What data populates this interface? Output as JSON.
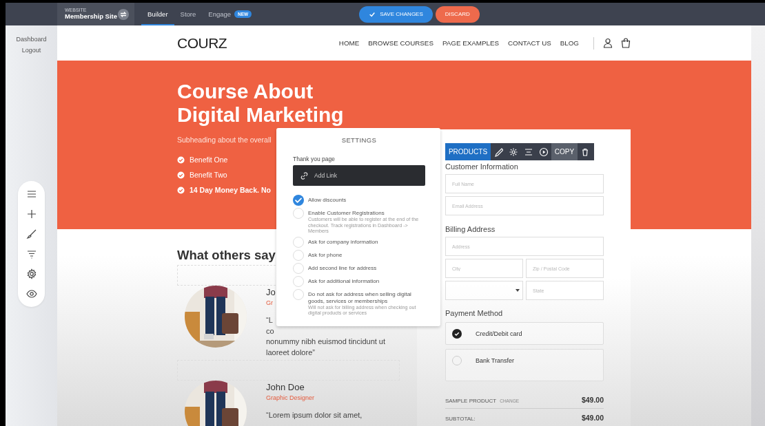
{
  "top_bar": {
    "website_label": "WEBSITE",
    "site_name": "Membership Site",
    "tabs": [
      {
        "label": "Builder",
        "selected": true
      },
      {
        "label": "Store",
        "selected": false
      },
      {
        "label": "Engage",
        "selected": false,
        "badge": "NEW"
      }
    ],
    "buttons": [
      {
        "label": "SAVE CHANGES",
        "kind": "primary"
      },
      {
        "label": "DISCARD",
        "kind": "danger"
      }
    ]
  },
  "sidebar": {
    "links": [
      "Dashboard",
      "Logout"
    ]
  },
  "site_header": {
    "logo": "COURZ",
    "nav": [
      "HOME",
      "BROWSE COURSES",
      "PAGE EXAMPLES",
      "CONTACT US",
      "BLOG"
    ]
  },
  "hero": {
    "title_lines": [
      "Course About",
      "Digital Marketing"
    ],
    "subheading": "Subheading about the overall",
    "benefits": [
      {
        "text": "Benefit One",
        "bold": false
      },
      {
        "text": "Benefit Two",
        "bold": false
      },
      {
        "text": "14 Day Money Back. No",
        "bold": true
      }
    ]
  },
  "testimonials": {
    "heading": "What others say",
    "items": [
      {
        "name": "Jo",
        "role": "Gr",
        "quote_lines": [
          "“L",
          "co",
          "nonummy nibh euismod tincidunt ut",
          "laoreet dolore”"
        ]
      },
      {
        "name": "John Doe",
        "role": "Graphic Designer",
        "quote_lines": [
          "“Lorem ipsum dolor sit amet,"
        ]
      }
    ]
  },
  "checkout": {
    "toolbar": {
      "label": "PRODUCTS",
      "copy": "COPY"
    },
    "customer_heading": "Customer Information",
    "customer_fields": [
      {
        "placeholder": "Full Name"
      },
      {
        "placeholder": "Email Address"
      }
    ],
    "billing_heading": "Billing Address",
    "billing_fields": [
      {
        "kind": "text",
        "placeholder": "Address",
        "wide": true
      },
      {
        "kind": "text",
        "placeholder": "City",
        "wide": false
      },
      {
        "kind": "text",
        "placeholder": "Zip / Postal Code",
        "wide": false
      },
      {
        "kind": "select",
        "wide": false
      },
      {
        "kind": "text",
        "placeholder": "State",
        "wide": false
      }
    ],
    "payment_heading": "Payment Method",
    "payment_options": [
      {
        "label": "Credit/Debit card",
        "selected": true
      },
      {
        "label": "Bank Transfer",
        "selected": false
      }
    ],
    "summary": [
      {
        "label": "SAMPLE PRODUCT",
        "action": "CHANGE",
        "amount": "$49.00"
      },
      {
        "label": "SUBTOTAL:",
        "amount": "$49.00"
      }
    ]
  },
  "settings_popover": {
    "title": "SETTINGS",
    "thank_you_label": "Thank you page",
    "link_button": "Add Link",
    "options": [
      {
        "label": "Allow discounts",
        "checked": true
      },
      {
        "label": "Enable Customer Registrations",
        "description": "Customers will be able to register at the end of the checkout. Track registrations in Dashboard -> Members",
        "checked": false
      },
      {
        "label": "Ask for company information",
        "checked": false
      },
      {
        "label": "Ask for phone",
        "checked": false
      },
      {
        "label": "Add second line for address",
        "checked": false
      },
      {
        "label": "Ask for additional information",
        "checked": false
      },
      {
        "label": "Do not ask for address when selling digital goods, services or memberships",
        "description": "Will not ask for billing address when checking out digital products or services",
        "checked": false
      }
    ]
  }
}
